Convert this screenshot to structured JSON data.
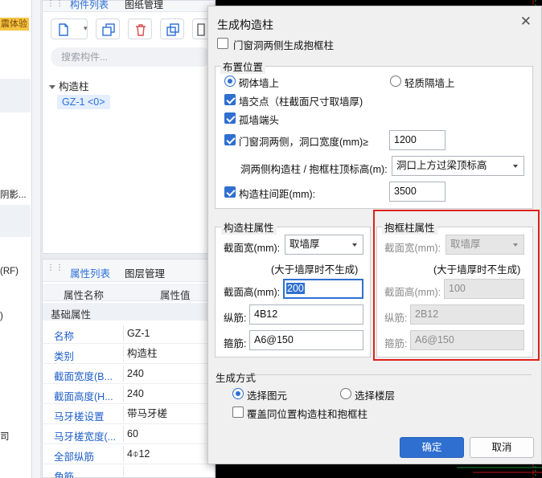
{
  "left_strip": {
    "badge": "震体验",
    "labels": [
      "阴影...",
      "(RF)",
      ")",
      "司"
    ]
  },
  "component_panel": {
    "tabs": [
      "构件列表",
      "图纸管理"
    ],
    "search_placeholder": "搜索构件...",
    "tree_root": "构造柱",
    "tree_item": "GZ-1 <0>"
  },
  "property_panel": {
    "tabs": [
      "属性列表",
      "图层管理"
    ],
    "col_name": "属性名称",
    "col_value": "属性值",
    "group": "基础属性",
    "rows": [
      {
        "name": "名称",
        "value": "GZ-1"
      },
      {
        "name": "类别",
        "value": "构造柱"
      },
      {
        "name": "截面宽度(B...",
        "value": "240"
      },
      {
        "name": "截面高度(H...",
        "value": "240"
      },
      {
        "name": "马牙槎设置",
        "value": "带马牙槎"
      },
      {
        "name": "马牙槎宽度(...",
        "value": "60"
      },
      {
        "name": "全部纵筋",
        "value": "4⌽12"
      },
      {
        "name": "角筋",
        "value": ""
      }
    ]
  },
  "dialog": {
    "title": "生成构造柱",
    "close_glyph": "✕",
    "door_window_frame": {
      "label": "门窗洞两侧生成抱框柱",
      "checked": false
    },
    "layout": {
      "title": "布置位置",
      "radio_masonry": {
        "label": "砌体墙上",
        "selected": true
      },
      "radio_light": {
        "label": "轻质隔墙上",
        "selected": false
      },
      "wall_intersection": {
        "label": "墙交点（柱截面尺寸取墙厚)",
        "checked": true
      },
      "isolated_wall_end": {
        "label": "孤墙端头",
        "checked": true
      },
      "door_window_sides": {
        "label": "门窗洞两侧，洞口宽度(mm)≥",
        "checked": true,
        "value": "1200"
      },
      "top_elevation": {
        "label": "洞两侧构造柱 / 抱框柱顶标高(m):",
        "value": "洞口上方过梁顶标高"
      },
      "spacing": {
        "label": "构造柱间距(mm):",
        "checked": true,
        "value": "3500"
      }
    },
    "column_props": {
      "title": "构造柱属性",
      "width_label": "截面宽(mm):",
      "width_value": "取墙厚",
      "note": "(大于墙厚时不生成)",
      "height_label": "截面高(mm):",
      "height_value": "200",
      "long_bar_label": "纵筋:",
      "long_bar_value": "4B12",
      "stirrup_label": "箍筋:",
      "stirrup_value": "A6@150"
    },
    "frame_props": {
      "title": "抱框柱属性",
      "width_label": "截面宽(mm):",
      "width_value": "取墙厚",
      "note": "(大于墙厚时不生成)",
      "height_label": "截面高(mm):",
      "height_value": "100",
      "long_bar_label": "纵筋:",
      "long_bar_value": "2B12",
      "stirrup_label": "箍筋:",
      "stirrup_value": "A6@150"
    },
    "generate": {
      "title": "生成方式",
      "radio_select_element": {
        "label": "选择图元",
        "selected": true
      },
      "radio_select_floor": {
        "label": "选择楼层",
        "selected": false
      },
      "overwrite": {
        "label": "覆盖同位置构造柱和抱框柱",
        "checked": false
      }
    },
    "ok_label": "确定",
    "cancel_label": "取消"
  },
  "colors": {
    "accent": "#2f6fd0",
    "highlight_box": "#e0201a",
    "cad_red": "#c21a1a",
    "cad_green": "#1aa33a"
  }
}
